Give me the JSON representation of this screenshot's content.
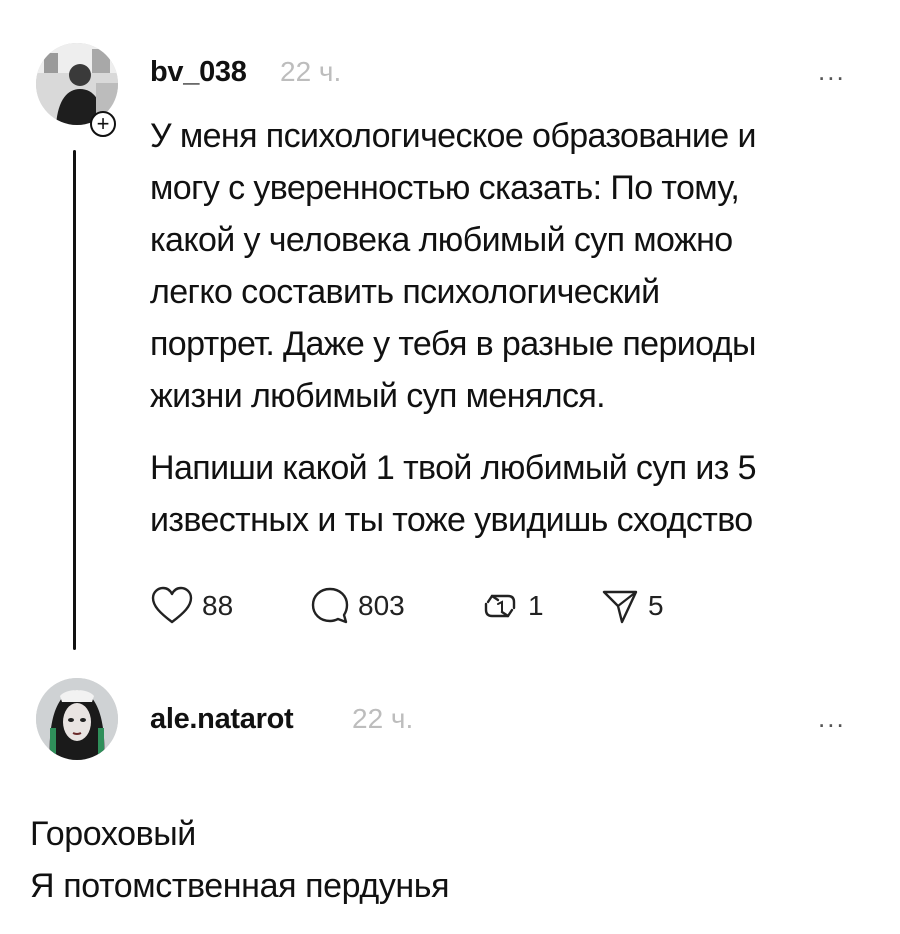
{
  "post": {
    "username": "bv_038",
    "time": "22 ч.",
    "more": "...",
    "follow_badge": "+",
    "body_lines": [
      "У меня психологическое образование и",
      "могу с уверенностью сказать: По тому,",
      "какой у человека любимый суп можно",
      "легко составить психологический",
      "портрет. Даже у тебя в разные периоды",
      "жизни любимый суп менялся."
    ],
    "body2_lines": [
      "Напиши какой 1 твой любимый суп из 5",
      "известных и ты тоже увидишь сходство"
    ],
    "actions": {
      "likes": "88",
      "comments": "803",
      "reposts": "1",
      "shares": "5"
    }
  },
  "reply": {
    "username": "ale.natarot",
    "time": "22 ч.",
    "more": "...",
    "lines": [
      "Гороховый",
      "Я потомственная пердунья"
    ]
  }
}
